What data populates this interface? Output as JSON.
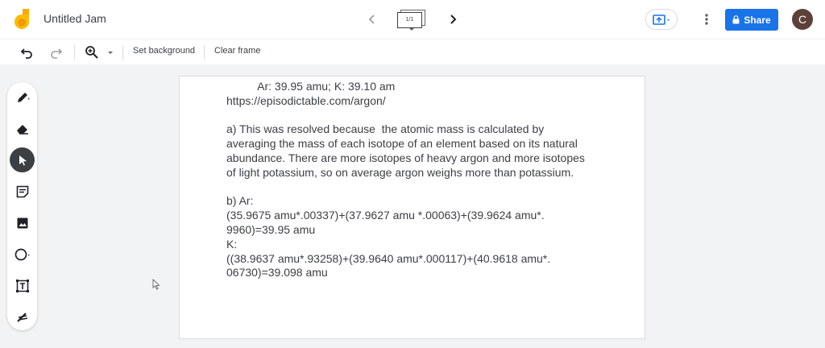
{
  "app": {
    "title": "Untitled Jam"
  },
  "frames": {
    "indicator": "1/1"
  },
  "header": {
    "share_label": "Share",
    "avatar_initial": "C"
  },
  "toolbar": {
    "set_background_label": "Set background",
    "clear_frame_label": "Clear frame"
  },
  "canvas": {
    "lines": [
      "          Ar: 39.95 amu; K: 39.10 am",
      "https://episodictable.com/argon/",
      "",
      "a) This was resolved because  the atomic mass is calculated by",
      "averaging the mass of each isotope of an element based on its natural",
      "abundance. There are more isotopes of heavy argon and more isotopes",
      "of light potassium, so on average argon weighs more than potassium.",
      "",
      "b) Ar:",
      "(35.9675 amu*.00337)+(37.9627 amu *.00063)+(39.9624 amu*.",
      "9960)=39.95 amu",
      "K:",
      "((38.9637 amu*.93258)+(39.9640 amu*.000117)+(40.9618 amu*.",
      "06730)=39.098 amu"
    ]
  },
  "icons": {
    "logo": "jamboard-logo-icon",
    "prev": "chevron-left-icon",
    "next": "chevron-right-icon",
    "present": "present-to-screen-icon",
    "more": "more-vert-icon",
    "lock": "lock-icon",
    "undo": "undo-icon",
    "redo": "redo-icon",
    "zoom": "zoom-in-icon",
    "tools": [
      "pen-icon",
      "eraser-icon",
      "select-arrow-icon",
      "sticky-note-icon",
      "image-icon",
      "circle-shape-icon",
      "text-box-icon",
      "laser-icon"
    ]
  },
  "colors": {
    "accent": "#1a73e8",
    "avatar_bg": "#5d4037",
    "active_tool": "#3c4043",
    "logo_yellow": "#fbbc04"
  }
}
